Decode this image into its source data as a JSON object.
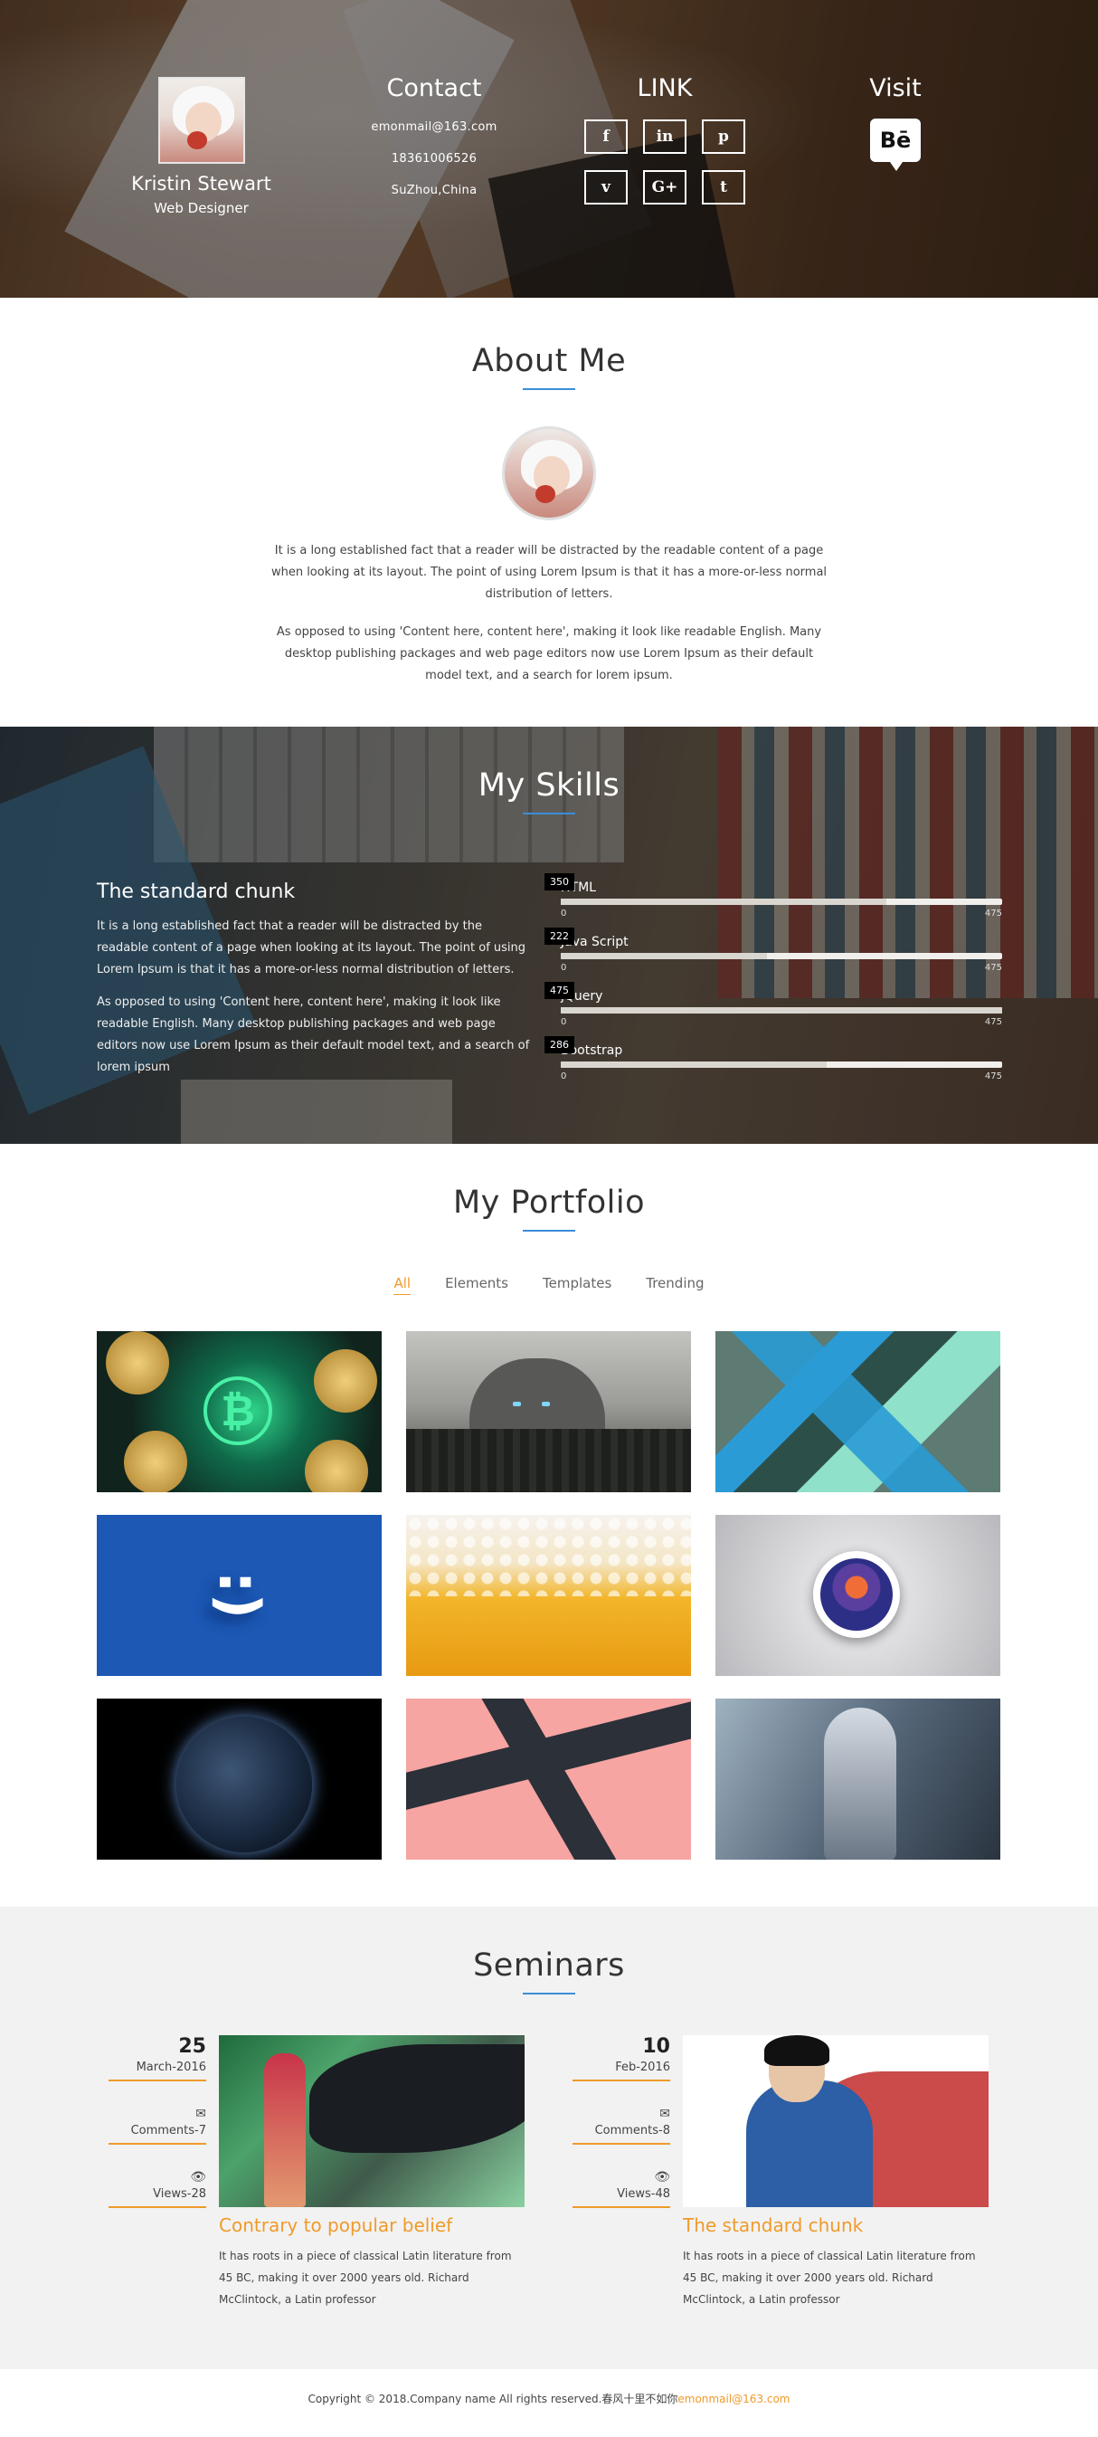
{
  "profile": {
    "name": "Kristin Stewart",
    "role": "Web Designer"
  },
  "contact": {
    "title": "Contact",
    "email": "emonmail@163.com",
    "phone": "18361006526",
    "city": "SuZhou,China"
  },
  "links": {
    "title": "LINK",
    "icons": [
      "facebook-icon",
      "linkedin-icon",
      "pinterest-icon",
      "vimeo-icon",
      "google-plus-icon",
      "tumblr-icon"
    ],
    "glyphs": [
      "f",
      "in",
      "p",
      "v",
      "G+",
      "t"
    ]
  },
  "visit": {
    "title": "Visit",
    "badge": "Bē"
  },
  "about": {
    "title": "About Me",
    "p1": "It is a long established fact that a reader will be distracted by the readable content of a page when looking at its layout. The point of using Lorem Ipsum is that it has a more-or-less normal distribution of letters.",
    "p2": "As opposed to using 'Content here, content here', making it look like readable English. Many desktop publishing packages and web page editors now use Lorem Ipsum as their default model text, and a search for lorem ipsum."
  },
  "skills": {
    "title": "My Skills",
    "heading": "The standard chunk",
    "p1": "It is a long established fact that a reader will be distracted by the readable content of a page when looking at its layout. The point of using Lorem Ipsum is that it has a more-or-less normal distribution of letters.",
    "p2": "As opposed to using 'Content here, content here', making it look like readable English. Many desktop publishing packages and web page editors now use Lorem Ipsum as their default model text, and a search of lorem ipsum",
    "items": [
      {
        "label": "HTML",
        "value": "350",
        "min": "0",
        "max": "475",
        "fraction": 0.737
      },
      {
        "label": "Java Script",
        "value": "222",
        "min": "0",
        "max": "475",
        "fraction": 0.467
      },
      {
        "label": "jQuery",
        "value": "475",
        "min": "0",
        "max": "475",
        "fraction": 1.0
      },
      {
        "label": "Bootstrap",
        "value": "286",
        "min": "0",
        "max": "475",
        "fraction": 0.602
      }
    ]
  },
  "portfolio": {
    "title": "My Portfolio",
    "filters": [
      "All",
      "Elements",
      "Templates",
      "Trending"
    ],
    "active_filter": "All"
  },
  "seminars": {
    "title": "Seminars",
    "items": [
      {
        "day": "25",
        "month": "March-2016",
        "comments": "Comments-7",
        "views": "Views-28",
        "title": "Contrary to popular belief",
        "text": "It has roots in a piece of classical Latin literature from 45 BC, making it over 2000 years old. Richard McClintock, a Latin professor"
      },
      {
        "day": "10",
        "month": "Feb-2016",
        "comments": "Comments-8",
        "views": "Views-48",
        "title": "The standard chunk",
        "text": "It has roots in a piece of classical Latin literature from 45 BC, making it over 2000 years old. Richard McClintock, a Latin professor"
      }
    ]
  },
  "footer": {
    "text": "Copyright © 2018.Company name All rights reserved.春风十里不如你",
    "email": "emonmail@163.com"
  },
  "colors": {
    "accent": "#f09a2a",
    "underline": "#3a8fd8",
    "seminar_bg": "#f2f2f2"
  }
}
